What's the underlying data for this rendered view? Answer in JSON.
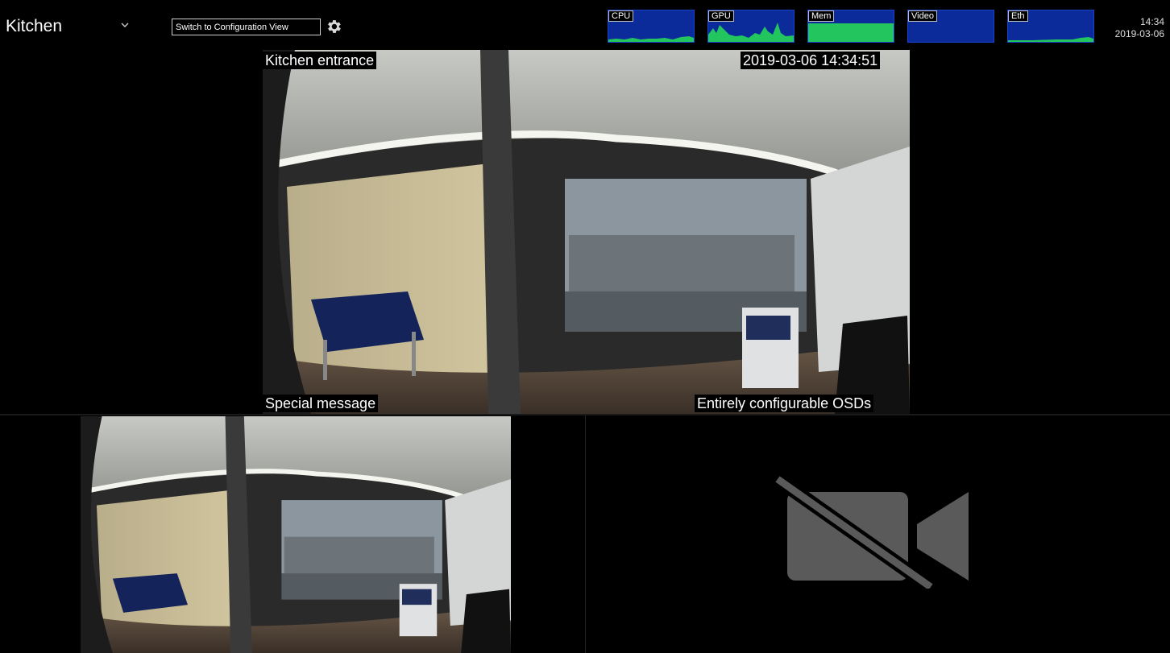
{
  "header": {
    "view_name": "Kitchen",
    "switch_button_label": "Switch to Configuration View",
    "clock_time": "14:34",
    "clock_date": "2019-03-06"
  },
  "meters": [
    {
      "label": "CPU",
      "level": 0.1
    },
    {
      "label": "GPU",
      "level": 0.35
    },
    {
      "label": "Mem",
      "level": 0.62
    },
    {
      "label": "Video",
      "level": 0.0
    },
    {
      "label": "Eth",
      "level": 0.05
    }
  ],
  "colors": {
    "meter_bg": "#0b2b9a",
    "meter_fill": "#22c55e",
    "nosignal_icon": "#5a5a5a"
  },
  "camera_main": {
    "osd_title": "Kitchen entrance",
    "osd_timestamp": "2019-03-06 14:34:51",
    "osd_message": "Special message",
    "osd_config": "Entirely configurable OSDs"
  },
  "camera_empty": {
    "icon": "video-off-icon"
  }
}
